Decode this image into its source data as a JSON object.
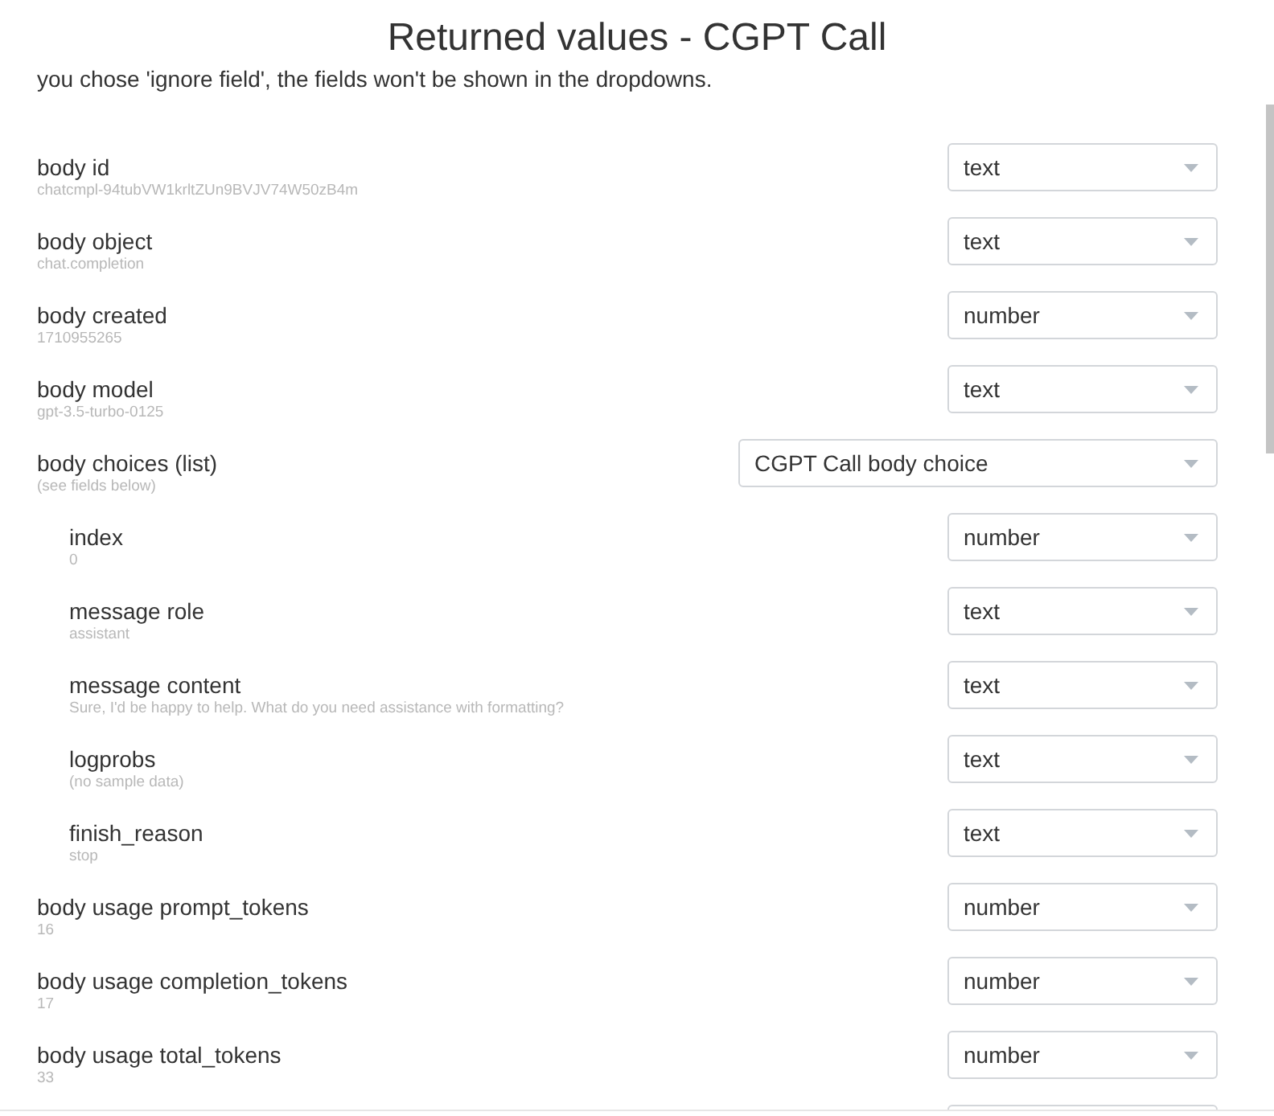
{
  "window": {
    "title": "Returned values - CGPT Call"
  },
  "note": "you chose 'ignore field', the fields won't be shown in the dropdowns.",
  "fields": [
    {
      "label": "body id",
      "sample": "chatcmpl-94tubVW1krltZUn9BVJV74W50zB4m",
      "type": "text"
    },
    {
      "label": "body object",
      "sample": "chat.completion",
      "type": "text"
    },
    {
      "label": "body created",
      "sample": "1710955265",
      "type": "number"
    },
    {
      "label": "body model",
      "sample": "gpt-3.5-turbo-0125",
      "type": "text"
    },
    {
      "label": "body choices (list)",
      "sample": "(see fields below)",
      "type": "CGPT Call body choice",
      "children": [
        {
          "label": "index",
          "sample": "0",
          "type": "number"
        },
        {
          "label": "message role",
          "sample": "assistant",
          "type": "text"
        },
        {
          "label": "message content",
          "sample": "Sure, I'd be happy to help. What do you need assistance with formatting?",
          "type": "text"
        },
        {
          "label": "logprobs",
          "sample": "(no sample data)",
          "type": "text"
        },
        {
          "label": "finish_reason",
          "sample": "stop",
          "type": "text"
        }
      ]
    },
    {
      "label": "body usage prompt_tokens",
      "sample": "16",
      "type": "number"
    },
    {
      "label": "body usage completion_tokens",
      "sample": "17",
      "type": "number"
    },
    {
      "label": "body usage total_tokens",
      "sample": "33",
      "type": "number"
    }
  ]
}
